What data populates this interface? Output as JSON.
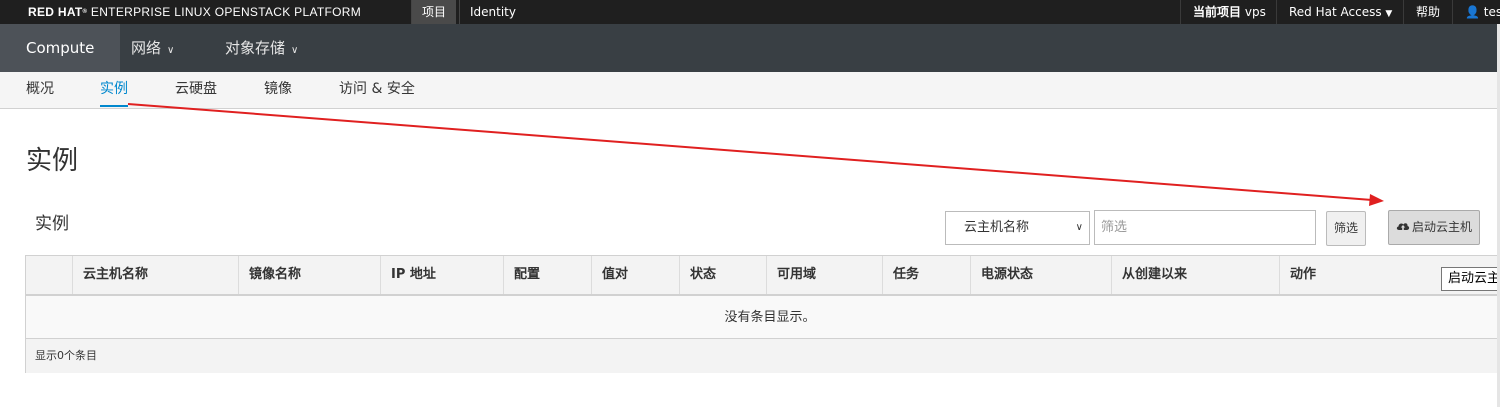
{
  "topbar": {
    "brand_bold": "RED HAT",
    "brand_mark": "®",
    "brand_rest": " ENTERPRISE LINUX OPENSTACK PLATFORM",
    "tabs": [
      {
        "label": "项目"
      },
      {
        "label": "Identity"
      }
    ],
    "current_project_label": "当前项目",
    "current_project_value": "vps",
    "redhat_access": "Red Hat Access",
    "help": "帮助",
    "user": "test"
  },
  "navbar": {
    "items": [
      {
        "label": "Compute"
      },
      {
        "label": "网络"
      },
      {
        "label": "对象存储"
      }
    ]
  },
  "subnav": {
    "items": [
      {
        "label": "概况"
      },
      {
        "label": "实例"
      },
      {
        "label": "云硬盘"
      },
      {
        "label": "镜像"
      },
      {
        "label": "访问 & 安全"
      }
    ]
  },
  "page": {
    "title": "实例",
    "table_title": "实例"
  },
  "filters": {
    "field_selected": "云主机名称",
    "input_placeholder": "筛选",
    "filter_button": "筛选",
    "launch_button": "启动云主机"
  },
  "table": {
    "columns": [
      "云主机名称",
      "镜像名称",
      "IP 地址",
      "配置",
      "值对",
      "状态",
      "可用域",
      "任务",
      "电源状态",
      "从创建以来",
      "动作"
    ],
    "empty_message": "没有条目显示。",
    "footer": "显示0个条目"
  },
  "tooltip": {
    "text": "启动云主机"
  },
  "colors": {
    "accent": "#0088ce",
    "annotation_arrow": "#e02020",
    "topbar_bg": "#1f1f1f",
    "navbar_bg": "#393f44"
  }
}
